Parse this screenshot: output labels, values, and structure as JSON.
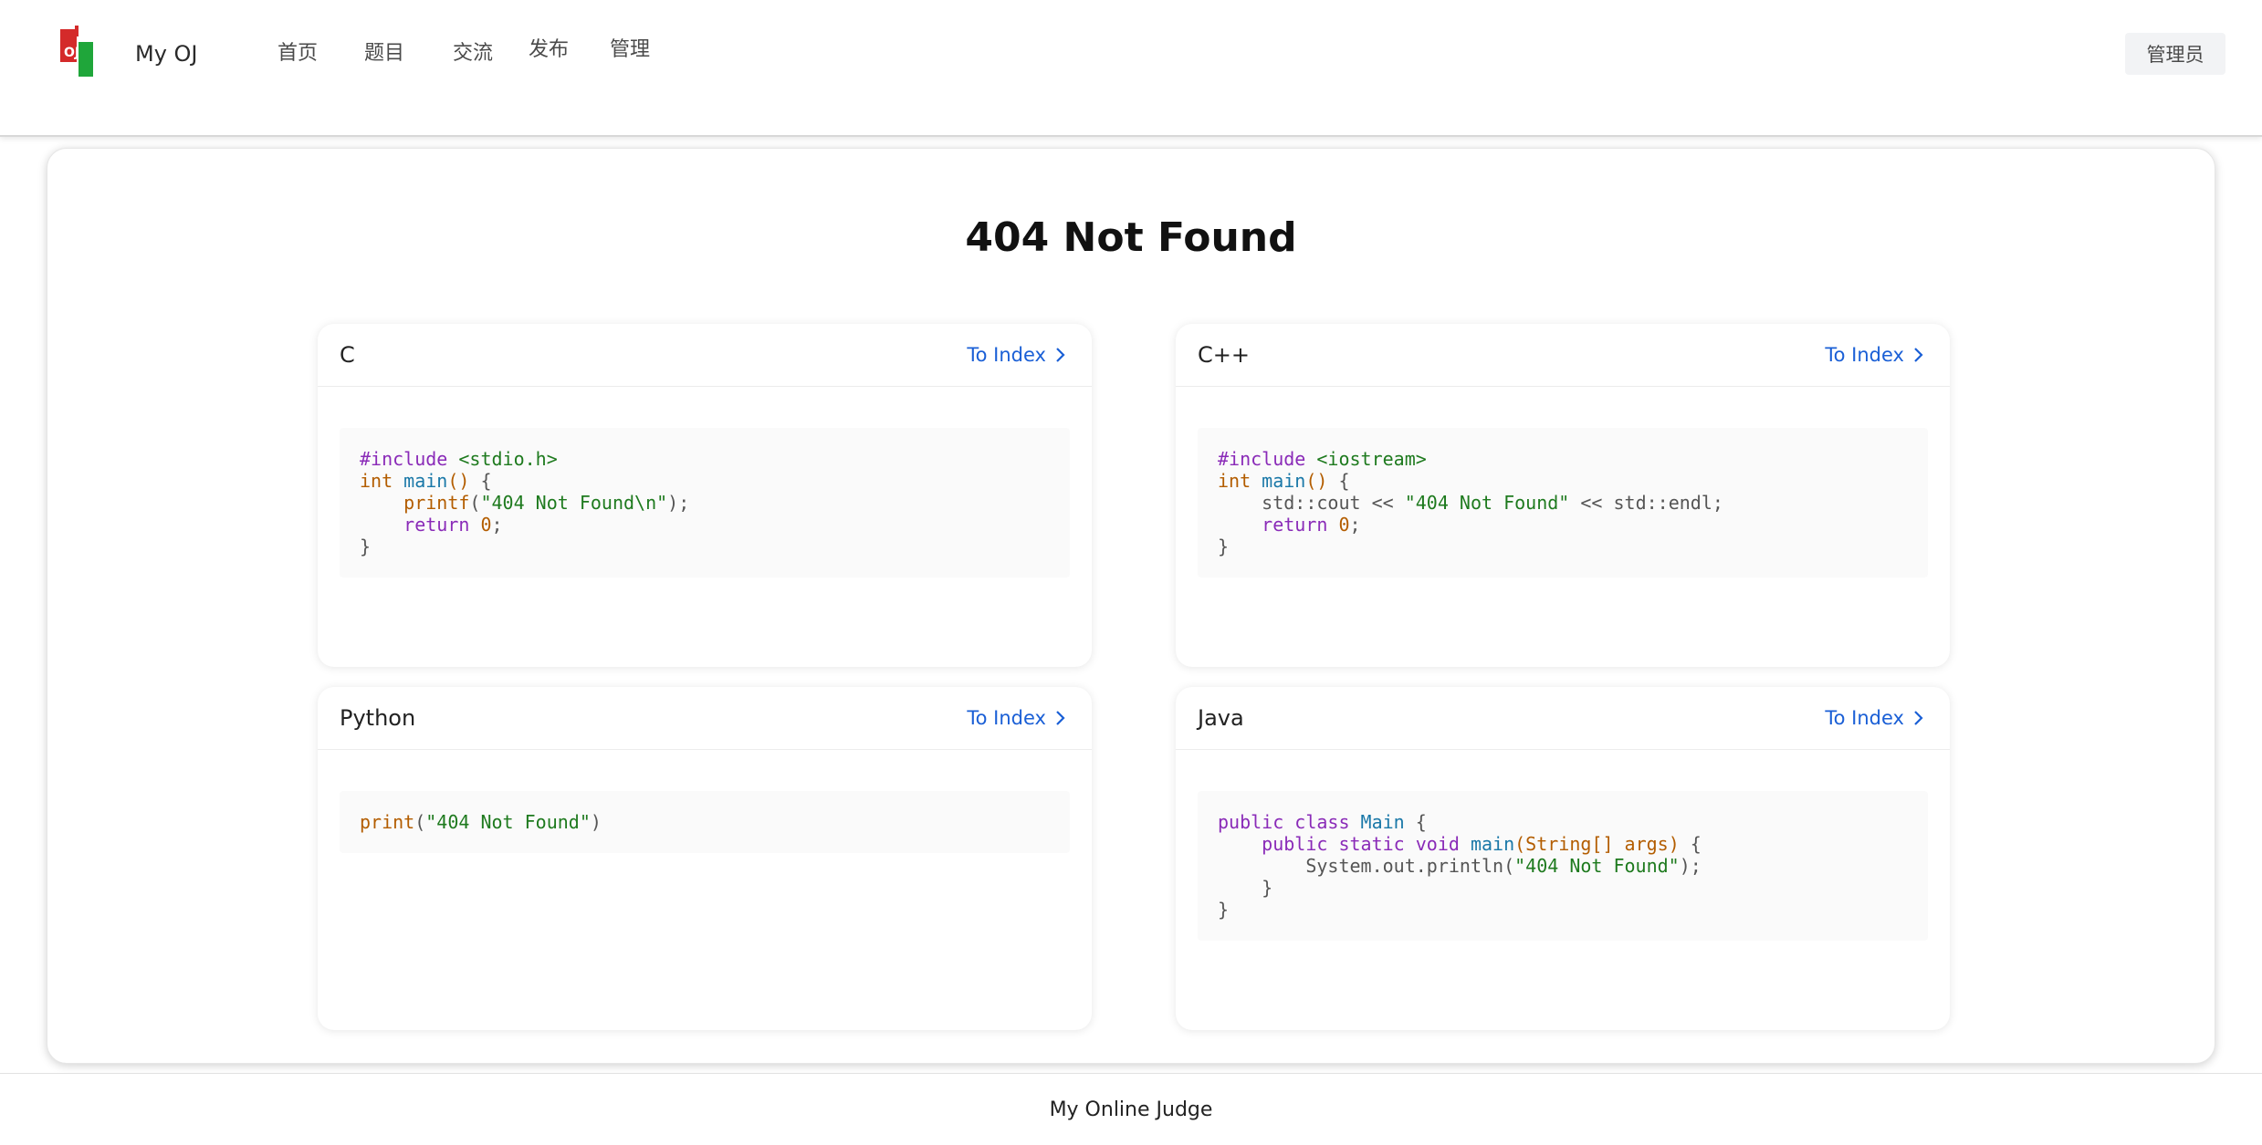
{
  "header": {
    "brand": "My OJ",
    "nav": [
      "首页",
      "题目",
      "交流",
      "发布",
      "管理"
    ],
    "user_button": "管理员"
  },
  "main": {
    "title": "404 Not Found",
    "cards": [
      {
        "title": "C",
        "link": "To Index",
        "code": [
          [
            {
              "c": "pp",
              "t": "#include "
            },
            {
              "c": "s",
              "t": "<stdio.h>"
            }
          ],
          [
            {
              "c": "t",
              "t": "int "
            },
            {
              "c": "f",
              "t": "main"
            },
            {
              "c": "n",
              "t": "()"
            },
            {
              "c": "p",
              "t": " {"
            }
          ],
          [
            {
              "c": "p",
              "t": "    "
            },
            {
              "c": "n",
              "t": "printf"
            },
            {
              "c": "p",
              "t": "("
            },
            {
              "c": "s",
              "t": "\"404 Not Found\\n\""
            },
            {
              "c": "p",
              "t": ");"
            }
          ],
          [
            {
              "c": "p",
              "t": "    "
            },
            {
              "c": "k",
              "t": "return "
            },
            {
              "c": "n",
              "t": "0"
            },
            {
              "c": "p",
              "t": ";"
            }
          ],
          [
            {
              "c": "p",
              "t": "}"
            }
          ]
        ]
      },
      {
        "title": "C++",
        "link": "To Index",
        "code": [
          [
            {
              "c": "pp",
              "t": "#include "
            },
            {
              "c": "s",
              "t": "<iostream>"
            }
          ],
          [
            {
              "c": "t",
              "t": "int "
            },
            {
              "c": "f",
              "t": "main"
            },
            {
              "c": "n",
              "t": "()"
            },
            {
              "c": "p",
              "t": " {"
            }
          ],
          [
            {
              "c": "p",
              "t": "    std::cout << "
            },
            {
              "c": "s",
              "t": "\"404 Not Found\""
            },
            {
              "c": "p",
              "t": " << std::endl;"
            }
          ],
          [
            {
              "c": "p",
              "t": "    "
            },
            {
              "c": "k",
              "t": "return "
            },
            {
              "c": "n",
              "t": "0"
            },
            {
              "c": "p",
              "t": ";"
            }
          ],
          [
            {
              "c": "p",
              "t": "}"
            }
          ]
        ]
      },
      {
        "title": "Python",
        "link": "To Index",
        "code": [
          [
            {
              "c": "n",
              "t": "print"
            },
            {
              "c": "p",
              "t": "("
            },
            {
              "c": "s",
              "t": "\"404 Not Found\""
            },
            {
              "c": "p",
              "t": ")"
            }
          ]
        ]
      },
      {
        "title": "Java",
        "link": "To Index",
        "code": [
          [
            {
              "c": "k",
              "t": "public class "
            },
            {
              "c": "ty",
              "t": "Main"
            },
            {
              "c": "p",
              "t": " {"
            }
          ],
          [
            {
              "c": "p",
              "t": "    "
            },
            {
              "c": "k",
              "t": "public static void "
            },
            {
              "c": "f",
              "t": "main"
            },
            {
              "c": "n",
              "t": "(String[] args)"
            },
            {
              "c": "p",
              "t": " {"
            }
          ],
          [
            {
              "c": "p",
              "t": "        System.out.println("
            },
            {
              "c": "s",
              "t": "\"404 Not Found\""
            },
            {
              "c": "p",
              "t": ");"
            }
          ],
          [
            {
              "c": "p",
              "t": "    }"
            }
          ],
          [
            {
              "c": "p",
              "t": "}"
            }
          ]
        ]
      }
    ]
  },
  "footer": {
    "text": "My Online Judge"
  },
  "colors": {
    "accent": "#1a5fd6",
    "logo_red": "#d42a2a",
    "logo_green": "#1fa63a"
  },
  "icons": [
    "oj-logo-icon",
    "chevron-right-icon"
  ]
}
